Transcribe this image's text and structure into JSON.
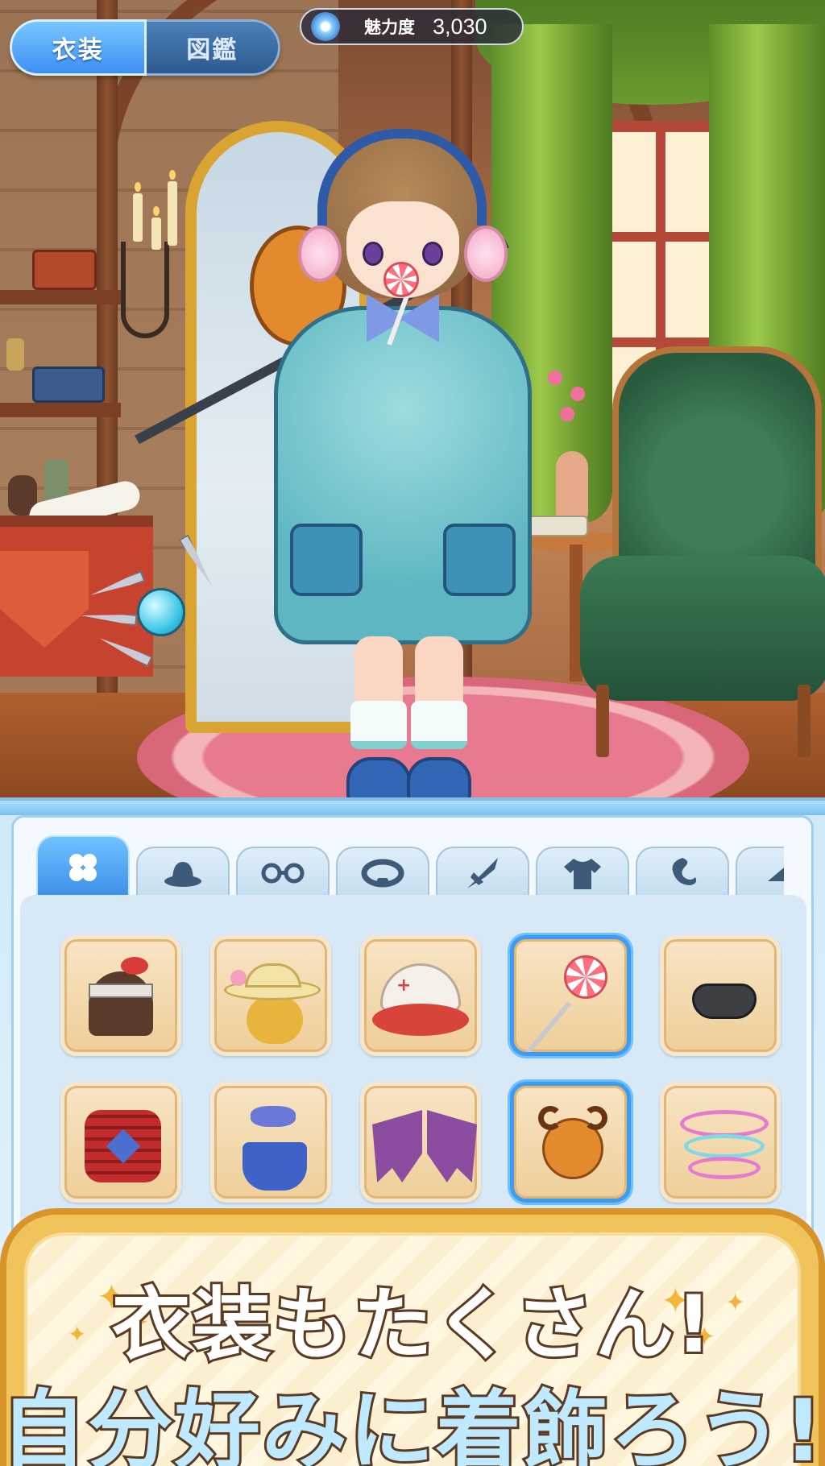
{
  "hud": {
    "tabs": [
      {
        "label": "衣装",
        "active": true
      },
      {
        "label": "図鑑",
        "active": false
      }
    ],
    "charm": {
      "icon": "gem-icon",
      "label": "魅力度",
      "value": "3,030"
    }
  },
  "inventory": {
    "categories": [
      {
        "icon": "clover-icon",
        "active": true
      },
      {
        "icon": "hat-icon",
        "active": false
      },
      {
        "icon": "glasses-icon",
        "active": false
      },
      {
        "icon": "collar-icon",
        "active": false
      },
      {
        "icon": "weapon-icon",
        "active": false
      },
      {
        "icon": "shirt-icon",
        "active": false
      },
      {
        "icon": "tail-icon",
        "active": false
      },
      {
        "icon": "hat-partial-icon",
        "active": false
      }
    ],
    "items": [
      {
        "name": "headband-hair",
        "selected": false
      },
      {
        "name": "flower-straw-hat",
        "selected": false
      },
      {
        "name": "nurse-cap",
        "selected": false
      },
      {
        "name": "lollipop",
        "selected": true
      },
      {
        "name": "half-mask",
        "selected": false
      },
      {
        "name": "samurai-armor",
        "selected": false
      },
      {
        "name": "bikini-outfit",
        "selected": false
      },
      {
        "name": "bat-wings",
        "selected": false
      },
      {
        "name": "goat-plush",
        "selected": true
      },
      {
        "name": "aura-rings",
        "selected": false
      }
    ]
  },
  "banner": {
    "line1": "衣装もたくさん!",
    "line2": "自分好みに着飾ろう!"
  },
  "colors": {
    "accent_blue": "#3d8ff2",
    "selected_border": "#3d9bf0",
    "item_bg": "#efcf9a",
    "banner_gold": "#f0c45a"
  }
}
